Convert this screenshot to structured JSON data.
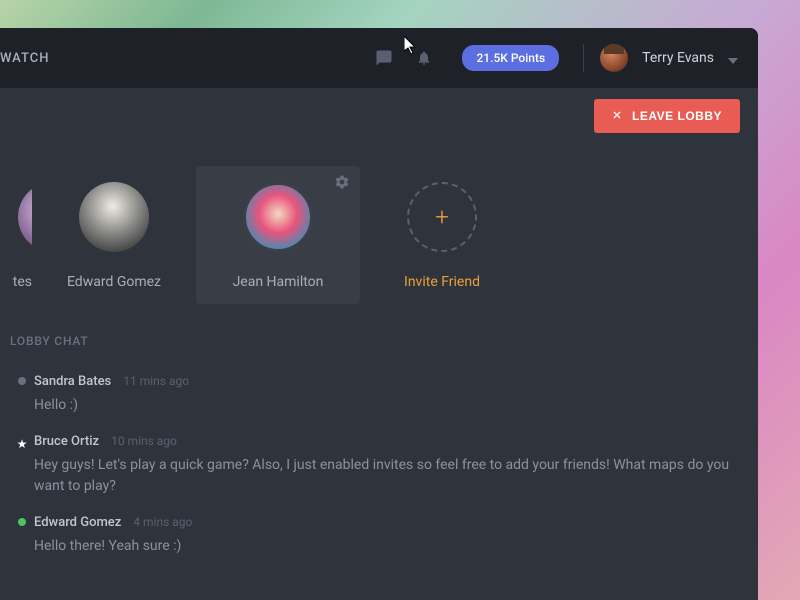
{
  "header": {
    "brand": "WATCH",
    "points": "21.5K Points",
    "username": "Terry Evans"
  },
  "leave_button": "LEAVE LOBBY",
  "players": [
    {
      "name_fragment": "tes"
    },
    {
      "name": "Edward Gomez"
    },
    {
      "name": "Jean Hamilton",
      "selected": true
    },
    {
      "name": "Invite Friend",
      "invite": true
    }
  ],
  "chat": {
    "title": "LOBBY CHAT",
    "messages": [
      {
        "author": "Sandra Bates",
        "time": "11 mins ago",
        "text": "Hello :)",
        "status": "away"
      },
      {
        "author": "Bruce Ortiz",
        "time": "10 mins ago",
        "text": "Hey guys! Let's play a quick game? Also, I just enabled invites so feel free to add your friends! What maps do you want to play?",
        "status": "host"
      },
      {
        "author": "Edward Gomez",
        "time": "4 mins ago",
        "text": "Hello there! Yeah sure :)",
        "status": "online"
      }
    ]
  }
}
